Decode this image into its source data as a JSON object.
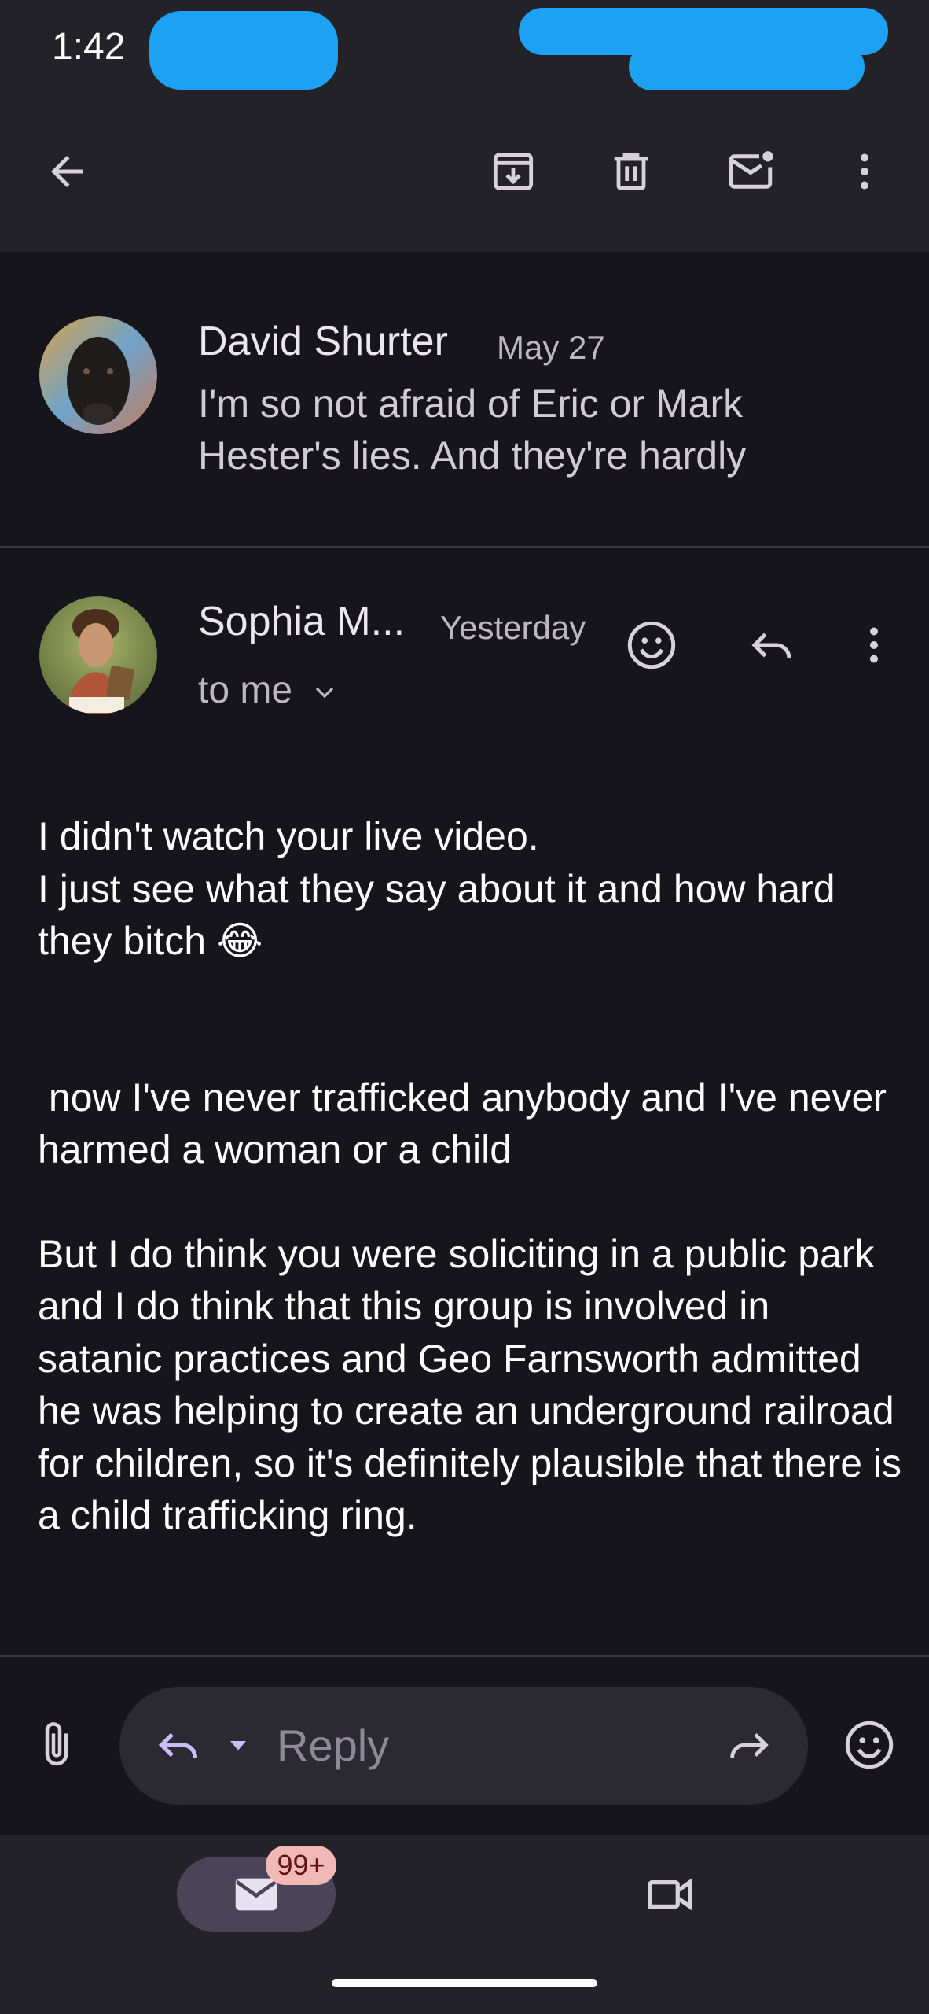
{
  "status_bar": {
    "time": "1:42"
  },
  "toolbar": {
    "back_icon": "arrow-back-icon",
    "archive_icon": "archive-icon",
    "delete_icon": "trash-icon",
    "mark_unread_icon": "mail-unread-icon",
    "more_icon": "more-vert-icon"
  },
  "thread": [
    {
      "sender": "David Shurter",
      "date": "May 27",
      "snippet": "I'm so not afraid of Eric or Mark Hester's lies. And they're hardly"
    },
    {
      "sender": "Sophia M...",
      "date": "Yesterday",
      "recipient": "to me",
      "body": [
        "I didn't watch your live video.\nI just see what they say about it and how hard they bitch 😂",
        " now I've never trafficked anybody and I've never harmed a woman or a child",
        "But I do think you were soliciting in a public park and I do think that this group is involved in satanic practices and Geo Farnsworth admitted he was helping to create an underground railroad for children, so it's definitely plausible that there is a child trafficking ring."
      ]
    }
  ],
  "reply": {
    "placeholder": "Reply"
  },
  "bottom_nav": {
    "mail_badge": "99+"
  },
  "colors": {
    "background": "#16151b",
    "surface": "#232228",
    "accent": "#c9bdf7",
    "badge": "#f2b8b5"
  }
}
